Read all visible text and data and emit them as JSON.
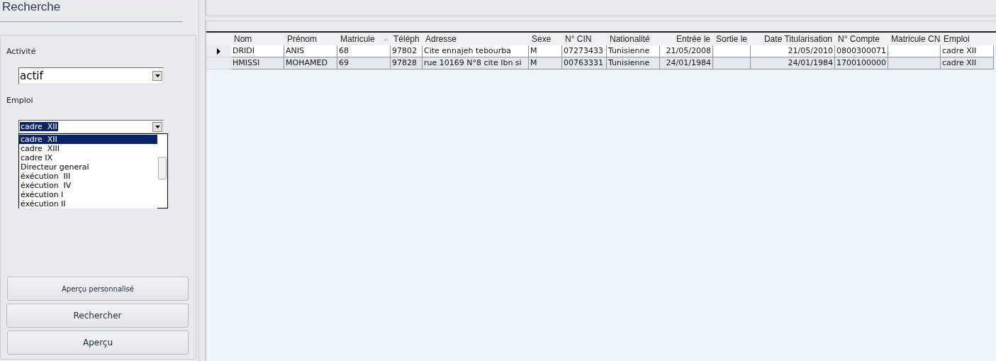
{
  "search_panel": {
    "title": "Recherche",
    "activity": {
      "label": "Activité",
      "value": "actif"
    },
    "job": {
      "label": "Emploi",
      "value": "cadre  XII",
      "expanded": true,
      "options": [
        {
          "label": "cadre  XII",
          "selected": true
        },
        {
          "label": "cadre  XIII",
          "selected": false
        },
        {
          "label": "cadre IX",
          "selected": false
        },
        {
          "label": "Directeur general",
          "selected": false
        },
        {
          "label": "éxécution  III",
          "selected": false
        },
        {
          "label": "éxécution  IV",
          "selected": false
        },
        {
          "label": "éxécution I",
          "selected": false
        },
        {
          "label": "éxécution II",
          "selected": false
        }
      ]
    },
    "buttons": [
      {
        "label": "Aperçu personnalisé",
        "kind": "small"
      },
      {
        "label": "Rechercher",
        "kind": "normal"
      },
      {
        "label": "Aperçu",
        "kind": "normal"
      }
    ]
  },
  "table": {
    "columns": [
      {
        "label": "Nom",
        "sorted": false
      },
      {
        "label": "Prénom",
        "sorted": false
      },
      {
        "label": "Matricule",
        "sorted": true
      },
      {
        "label": "Téléph",
        "sorted": false
      },
      {
        "label": "Adresse",
        "sorted": false
      },
      {
        "label": "Sexe",
        "sorted": false
      },
      {
        "label": "N° CIN",
        "sorted": false
      },
      {
        "label": "Nationalité",
        "sorted": false
      },
      {
        "label": "Entrée le",
        "sorted": false
      },
      {
        "label": "Sortie le",
        "sorted": false
      },
      {
        "label": "Date Titularisation",
        "sorted": false
      },
      {
        "label": "N° Compte",
        "sorted": false
      },
      {
        "label": "Matricule CN",
        "sorted": false
      },
      {
        "label": "Emploi",
        "sorted": false
      }
    ],
    "rows": [
      {
        "selected": true,
        "cells": [
          "DRIDI",
          "ANIS",
          "68",
          "97802",
          "Cite ennajeh tebourba",
          "M",
          "07273433",
          "Tunisienne",
          "21/05/2008",
          "",
          "21/05/2010",
          "0800300071",
          "",
          "cadre  XII"
        ]
      },
      {
        "selected": false,
        "cells": [
          "HMISSI",
          "MOHAMED",
          "69",
          "97828",
          "rue 10169 N°8 cite Ibn si",
          "M",
          "00763331",
          "Tunisienne",
          "24/01/1984",
          "",
          "24/01/1984",
          "1700100000",
          "",
          "cadre  XII"
        ]
      }
    ]
  }
}
